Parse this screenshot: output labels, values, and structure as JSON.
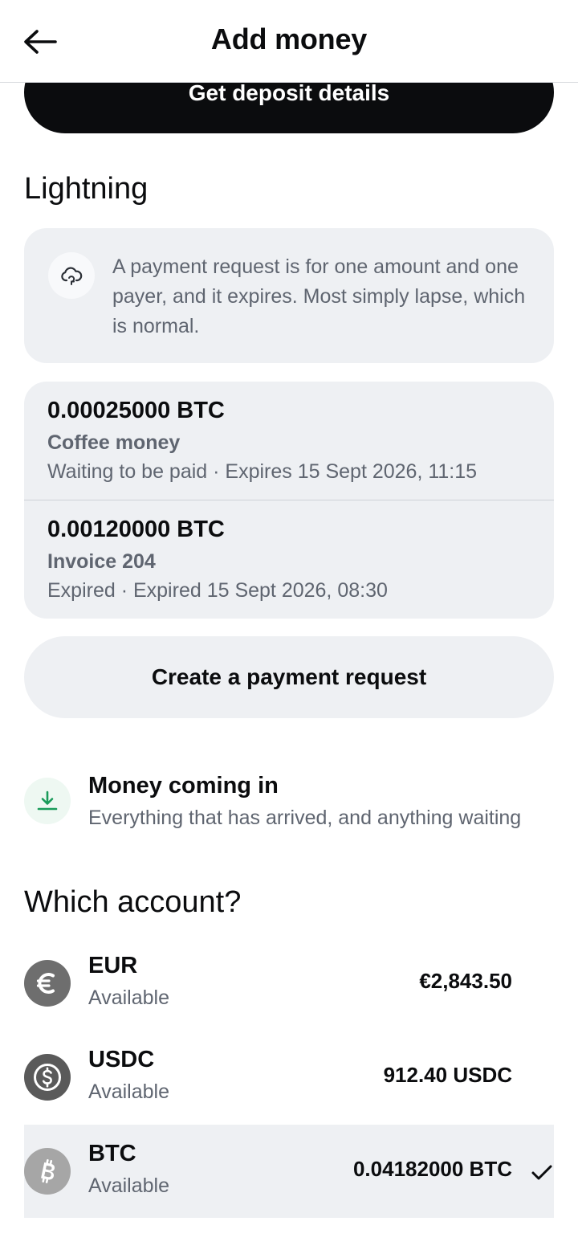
{
  "header": {
    "title": "Add money",
    "back_icon": "arrow-left-icon"
  },
  "deposit": {
    "button_label": "Get deposit details"
  },
  "lightning": {
    "title": "Lightning",
    "info_icon": "cloud-refresh-icon",
    "info_text": "A payment request is for one amount and one payer, and it expires. Most simply lapse, which is normal.",
    "requests": [
      {
        "amount": "0.00025000 BTC",
        "label": "Coffee money",
        "status": "Waiting to be paid · Expires 15 Sept 2026, 11:15"
      },
      {
        "amount": "0.00120000 BTC",
        "label": "Invoice 204",
        "status": "Expired · Expired 15 Sept 2026, 08:30"
      }
    ],
    "create_label": "Create a payment request"
  },
  "incoming": {
    "icon": "download-icon",
    "title": "Money coming in",
    "subtitle": "Everything that has arrived, and anything waiting"
  },
  "accounts": {
    "title": "Which account?",
    "items": [
      {
        "name": "EUR",
        "sub": "Available",
        "balance": "€2,843.50",
        "icon": "euro-icon",
        "selected": false
      },
      {
        "name": "USDC",
        "sub": "Available",
        "balance": "912.40 USDC",
        "icon": "usdc-icon",
        "selected": false
      },
      {
        "name": "BTC",
        "sub": "Available",
        "balance": "0.04182000 BTC",
        "icon": "bitcoin-icon",
        "selected": true
      }
    ]
  },
  "colors": {
    "primary": "#0b0c0e",
    "surface": "#eef0f3",
    "muted_text": "#5f6570",
    "success": "#1a9b5a",
    "euro_icon_bg": "#6e6e6e",
    "usdc_icon_bg": "#5a5a5a",
    "btc_icon_bg": "#a6a6a6"
  }
}
